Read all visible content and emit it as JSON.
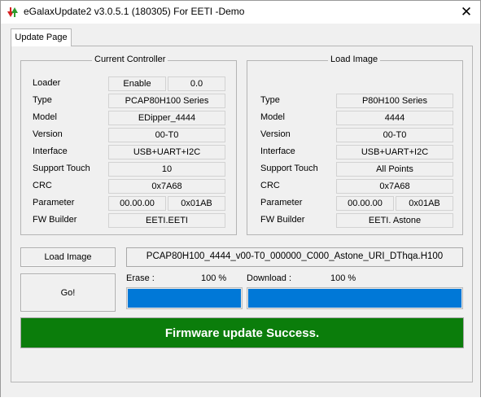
{
  "window": {
    "title": "eGalaxUpdate2 v3.0.5.1 (180305) For EETI -Demo",
    "close_glyph": "✕"
  },
  "tab": {
    "label": "Update Page"
  },
  "current_controller": {
    "title": "Current Controller",
    "rows": [
      {
        "label": "Loader",
        "value": "Enable",
        "value2": "0.0"
      },
      {
        "label": "Type",
        "value": "PCAP80H100 Series"
      },
      {
        "label": "Model",
        "value": "EDipper_4444"
      },
      {
        "label": "Version",
        "value": "00-T0"
      },
      {
        "label": "Interface",
        "value": "USB+UART+I2C"
      },
      {
        "label": "Support Touch",
        "value": "10"
      },
      {
        "label": "CRC",
        "value": "0x7A68"
      },
      {
        "label": "Parameter",
        "value": "00.00.00",
        "value2": "0x01AB"
      },
      {
        "label": "FW Builder",
        "value": "EETI.EETI"
      }
    ]
  },
  "load_image_group": {
    "title": "Load Image",
    "rows": [
      {
        "label": "Type",
        "value": "P80H100 Series"
      },
      {
        "label": "Model",
        "value": "4444"
      },
      {
        "label": "Version",
        "value": "00-T0"
      },
      {
        "label": "Interface",
        "value": "USB+UART+I2C"
      },
      {
        "label": "Support Touch",
        "value": "All Points"
      },
      {
        "label": "CRC",
        "value": "0x7A68"
      },
      {
        "label": "Parameter",
        "value": "00.00.00",
        "value2": "0x01AB"
      },
      {
        "label": "FW Builder",
        "value": "EETI. Astone"
      }
    ]
  },
  "actions": {
    "load_image_label": "Load Image",
    "image_file": "PCAP80H100_4444_v00-T0_000000_C000_Astone_URI_DThqa.H100",
    "go_label": "Go!"
  },
  "progress": {
    "erase_label": "Erase :",
    "erase_percent_text": "100 %",
    "erase_value": 1.0,
    "download_label": "Download :",
    "download_percent_text": "100 %",
    "download_value": 1.0
  },
  "status": {
    "message": "Firmware update Success.",
    "color": "#0b7d0b"
  },
  "colors": {
    "progress_fill": "#0078d7",
    "window_bg": "#f0f0f0"
  }
}
